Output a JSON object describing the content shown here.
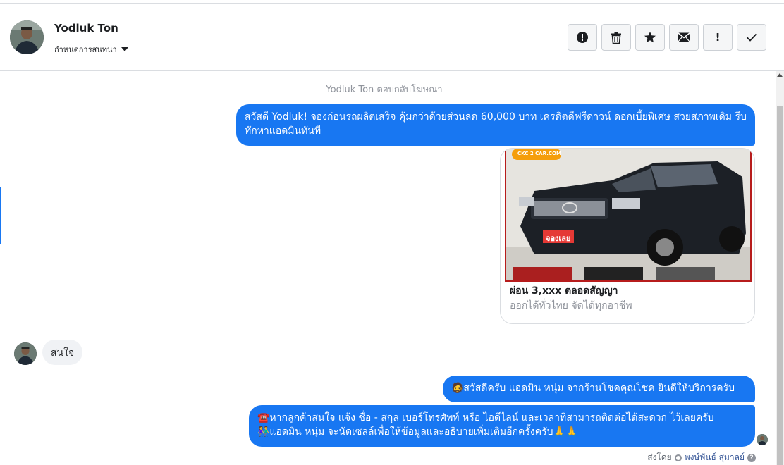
{
  "conversation": {
    "contact_name": "Yodluk Ton",
    "assign_label": "กำหนดการสนทนา",
    "actions": [
      {
        "icon": "alert-circle-icon",
        "name": "mark-spam-button"
      },
      {
        "icon": "trash-icon",
        "name": "delete-button"
      },
      {
        "icon": "star-icon",
        "name": "star-button"
      },
      {
        "icon": "mail-icon",
        "name": "mark-unread-button"
      },
      {
        "icon": "exclamation-icon",
        "label": "!",
        "name": "follow-up-button"
      },
      {
        "icon": "check-icon",
        "name": "mark-done-button"
      }
    ]
  },
  "messages": {
    "system_note": "Yodluk Ton ตอบกลับโฆษณา",
    "ad_text": "สวัสดี Yodluk! จองก่อนรถผลิตเสร็จ คุ้มกว่าด้วยส่วนลด 60,000 บาท เครดิตดีฟรีดาวน์ ดอกเบี้ยพิเศษ สวยสภาพเดิม รีบทักหาแอดมินทันที",
    "ad_card": {
      "title": "ผ่อน 3,xxx ตลอดสัญญา",
      "subtitle": "ออกได้ทั่วไทย จัดได้ทุกอาชีพ",
      "badge": "CKC 2 CAR.COM",
      "sticker": "จองเลย"
    },
    "customer_reply": "สนใจ",
    "admin_greeting": "🧔สวัสดีครับ แอดมิน หนุ่ม จากร้านโชคคุณโชค ยินดีให้บริการครับ",
    "admin_request_line1": "☎️หากลูกค้าสนใจ แจ้ง ชื่อ - สกุล เบอร์โทรศัพท์ หรือ ไอดีไลน์ และเวลาที่สามารถติดต่อได้สะดวก ไว้เลยครับ",
    "admin_request_line2": "👫แอดมิน หนุ่ม จะนัดเซลล์เพื่อให้ข้อมูลและอธิบายเพิ่มเติมอีกครั้งครับ🙏🙏"
  },
  "footer": {
    "sent_by_label": "ส่งโดย",
    "sender": "พงษ์พันธ์ สุมาลย์"
  },
  "colors": {
    "accent": "#1877f2",
    "incoming_bubble": "#f0f2f5",
    "border": "#dadde1"
  }
}
